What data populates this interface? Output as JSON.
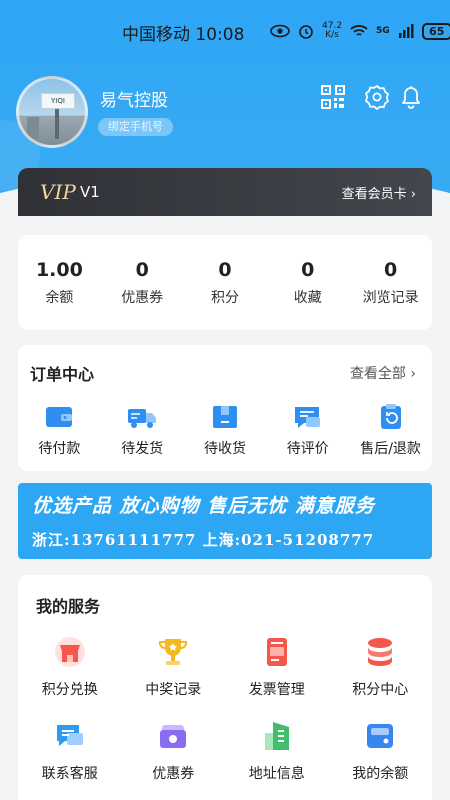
{
  "status_bar": {
    "carrier_time": "中国移动 10:08",
    "net_speed_top": "47.2",
    "net_speed_bottom": "K/s",
    "network": "5G",
    "battery": "65"
  },
  "profile": {
    "name": "易气控股",
    "bind_phone": "绑定手机号",
    "avatar_text": "YIQI"
  },
  "vip": {
    "logo": "VIP",
    "level": "V1",
    "card_link": "查看会员卡 ›"
  },
  "stats": [
    {
      "value": "1.00",
      "label": "余额"
    },
    {
      "value": "0",
      "label": "优惠券"
    },
    {
      "value": "0",
      "label": "积分"
    },
    {
      "value": "0",
      "label": "收藏"
    },
    {
      "value": "0",
      "label": "浏览记录"
    }
  ],
  "orders": {
    "title": "订单中心",
    "view_all": "查看全部 ›",
    "items": [
      {
        "label": "待付款",
        "icon": "wallet-icon"
      },
      {
        "label": "待发货",
        "icon": "truck-icon"
      },
      {
        "label": "待收货",
        "icon": "box-icon"
      },
      {
        "label": "待评价",
        "icon": "review-icon"
      },
      {
        "label": "售后/退款",
        "icon": "refund-icon"
      }
    ]
  },
  "banner": {
    "line1": "优选产品  放心购物  售后无忧  满意服务",
    "line2": "浙江:13761111777  上海:021-51208777"
  },
  "services": {
    "title": "我的服务",
    "items": [
      {
        "label": "积分兑换",
        "icon": "store-icon",
        "color": "#f5574a"
      },
      {
        "label": "中奖记录",
        "icon": "trophy-icon",
        "color": "#f6b81f"
      },
      {
        "label": "发票管理",
        "icon": "invoice-icon",
        "color": "#f5574a"
      },
      {
        "label": "积分中心",
        "icon": "coins-icon",
        "color": "#f5574a"
      },
      {
        "label": "联系客服",
        "icon": "chat-icon",
        "color": "#2e9af0"
      },
      {
        "label": "优惠券",
        "icon": "coupon-icon",
        "color": "#8a6cf0"
      },
      {
        "label": "地址信息",
        "icon": "building-icon",
        "color": "#3fbf6c"
      },
      {
        "label": "我的余额",
        "icon": "wallet-card-icon",
        "color": "#3a86f0"
      }
    ]
  },
  "colors": {
    "primary": "#2ea6f5",
    "vip_gold": "#f0d79c"
  }
}
